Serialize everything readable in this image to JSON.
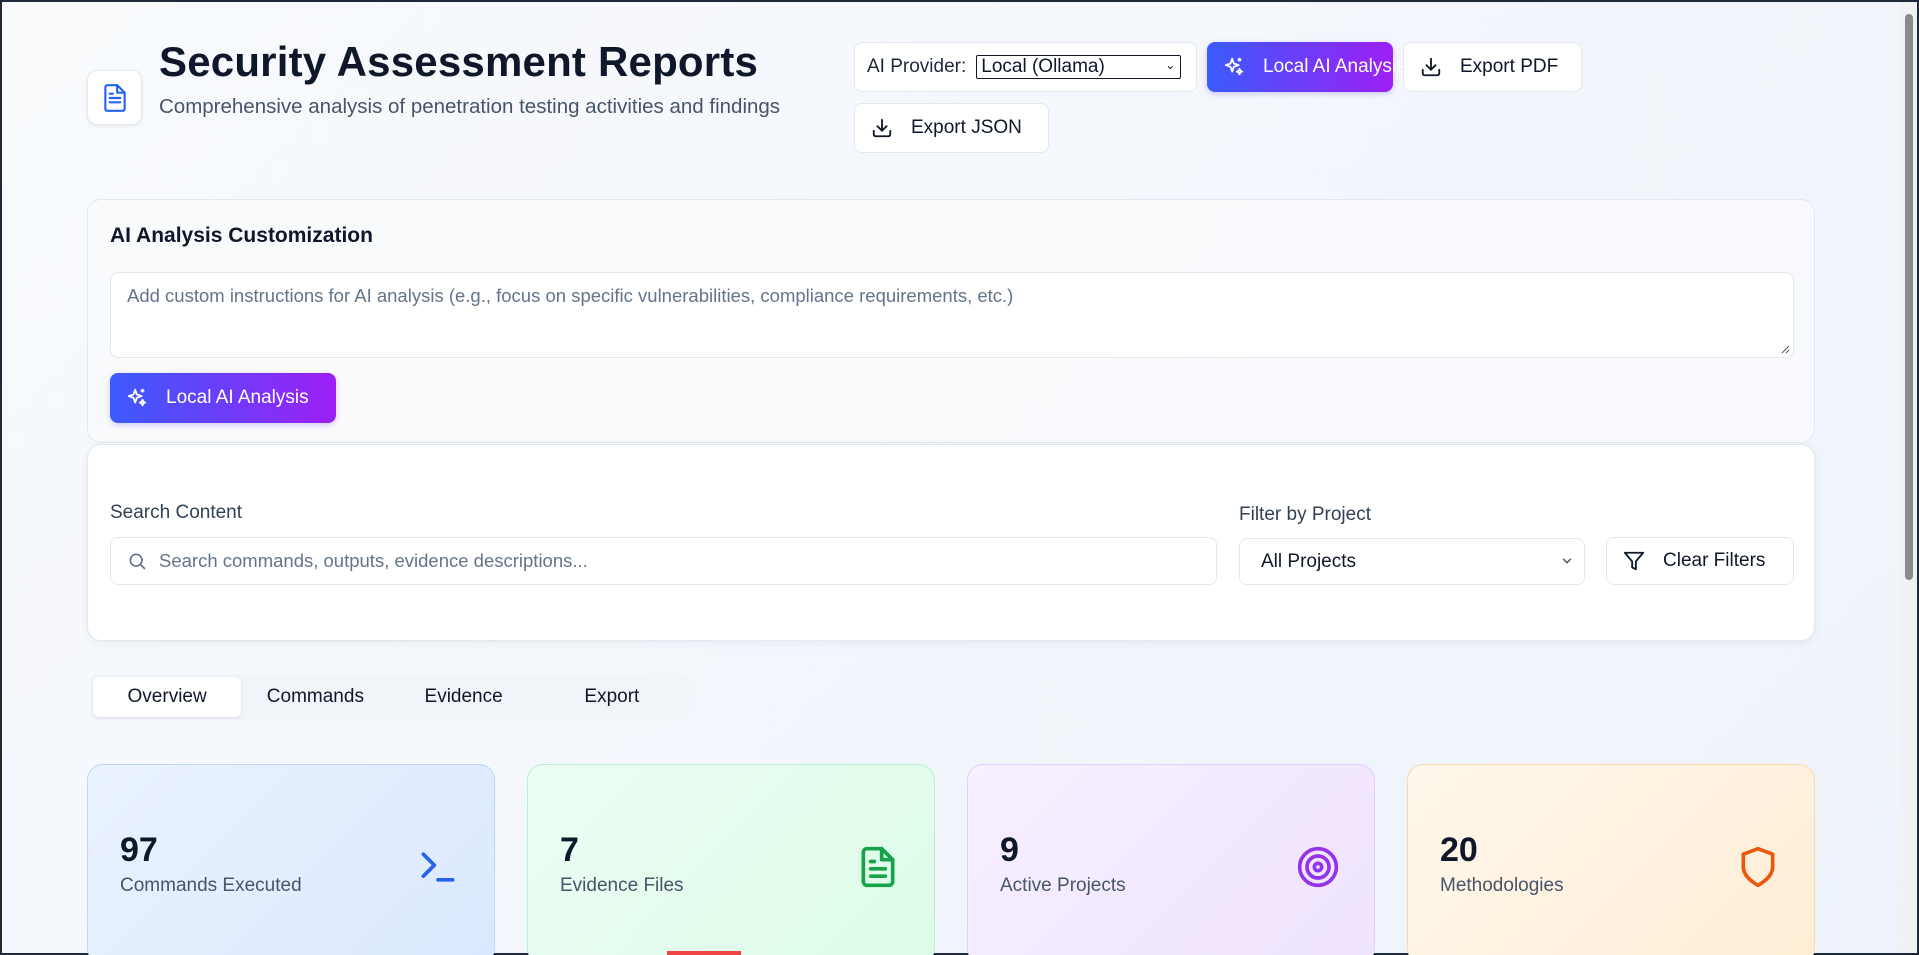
{
  "header": {
    "title": "Security Assessment Reports",
    "subtitle": "Comprehensive analysis of penetration testing activities and findings",
    "provider_label": "AI Provider:",
    "provider_value": "Local (Ollama)",
    "ai_button": "Local AI Analysis",
    "export_pdf": "Export PDF",
    "export_json": "Export JSON"
  },
  "ai_customization": {
    "title": "AI Analysis Customization",
    "placeholder": "Add custom instructions for AI analysis (e.g., focus on specific vulnerabilities, compliance requirements, etc.)",
    "button": "Local AI Analysis"
  },
  "filters": {
    "search_label": "Search Content",
    "search_placeholder": "Search commands, outputs, evidence descriptions...",
    "project_label": "Filter by Project",
    "project_value": "All Projects",
    "clear_button": "Clear Filters"
  },
  "tabs": [
    {
      "label": "Overview",
      "active": true
    },
    {
      "label": "Commands",
      "active": false
    },
    {
      "label": "Evidence",
      "active": false
    },
    {
      "label": "Export",
      "active": false
    }
  ],
  "stats": [
    {
      "value": "97",
      "label": "Commands Executed",
      "icon": "terminal-icon",
      "color": "#2563eb"
    },
    {
      "value": "7",
      "label": "Evidence Files",
      "icon": "file-text-icon",
      "color": "#16a34a"
    },
    {
      "value": "9",
      "label": "Active Projects",
      "icon": "target-icon",
      "color": "#9333ea"
    },
    {
      "value": "20",
      "label": "Methodologies",
      "icon": "shield-icon",
      "color": "#ea580c"
    }
  ],
  "colors": {
    "accent_gradient_start": "#3b5bfd",
    "accent_gradient_end": "#9d1ff5",
    "doc_icon": "#2563eb"
  }
}
